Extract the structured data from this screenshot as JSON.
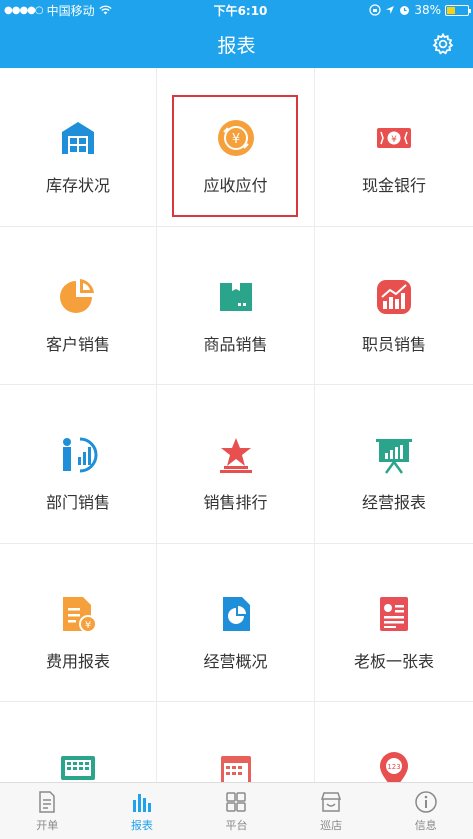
{
  "status_bar": {
    "carrier": "中国移动",
    "time": "下午6:10",
    "battery": "38%"
  },
  "header": {
    "title": "报表",
    "settings_icon": "gear-icon"
  },
  "colors": {
    "primary": "#1ea3ec",
    "orange": "#f5a03a",
    "red": "#e85050",
    "teal": "#2aa58c"
  },
  "grid": {
    "items": [
      {
        "label": "库存状况",
        "icon": "warehouse-icon"
      },
      {
        "label": "应收应付",
        "icon": "yen-exchange-icon"
      },
      {
        "label": "现金银行",
        "icon": "cash-icon"
      },
      {
        "label": "客户销售",
        "icon": "pie-chart-icon"
      },
      {
        "label": "商品销售",
        "icon": "box-icon"
      },
      {
        "label": "职员销售",
        "icon": "trend-icon"
      },
      {
        "label": "部门销售",
        "icon": "department-icon"
      },
      {
        "label": "销售排行",
        "icon": "ranking-icon"
      },
      {
        "label": "经营报表",
        "icon": "presentation-icon"
      },
      {
        "label": "费用报表",
        "icon": "expense-icon"
      },
      {
        "label": "经营概况",
        "icon": "overview-icon"
      },
      {
        "label": "老板一张表",
        "icon": "report-sheet-icon"
      },
      {
        "label": "",
        "icon": "monitor-icon"
      },
      {
        "label": "",
        "icon": "calendar-icon"
      },
      {
        "label": "",
        "icon": "location-pin-icon"
      }
    ]
  },
  "tabbar": {
    "tabs": [
      {
        "label": "开单",
        "icon": "document-icon",
        "active": false
      },
      {
        "label": "报表",
        "icon": "bar-chart-icon",
        "active": true
      },
      {
        "label": "平台",
        "icon": "grid-icon",
        "active": false
      },
      {
        "label": "巡店",
        "icon": "store-icon",
        "active": false
      },
      {
        "label": "信息",
        "icon": "info-icon",
        "active": false
      }
    ]
  }
}
